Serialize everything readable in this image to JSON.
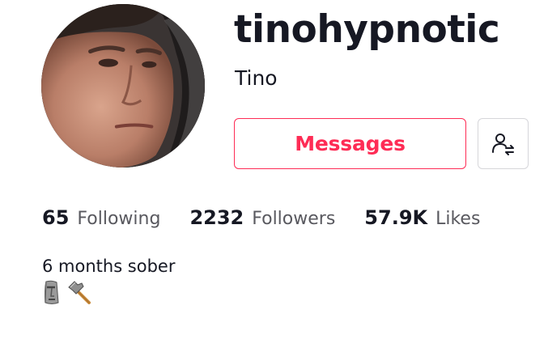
{
  "profile": {
    "username": "tinohypnotic",
    "display_name": "Tino",
    "avatar_alt": "profile photo"
  },
  "actions": {
    "messages_label": "Messages",
    "user_switch_icon": "user-switch-icon"
  },
  "stats": [
    {
      "value": "65",
      "label": "Following"
    },
    {
      "value": "2232",
      "label": "Followers"
    },
    {
      "value": "57.9K",
      "label": "Likes"
    }
  ],
  "bio": {
    "text": "6 months sober",
    "emojis": [
      "moai-icon",
      "hammer-icon"
    ]
  },
  "colors": {
    "accent": "#fe2c55",
    "text_primary": "#161823",
    "text_secondary": "#59595f",
    "border": "#d6d6da"
  }
}
